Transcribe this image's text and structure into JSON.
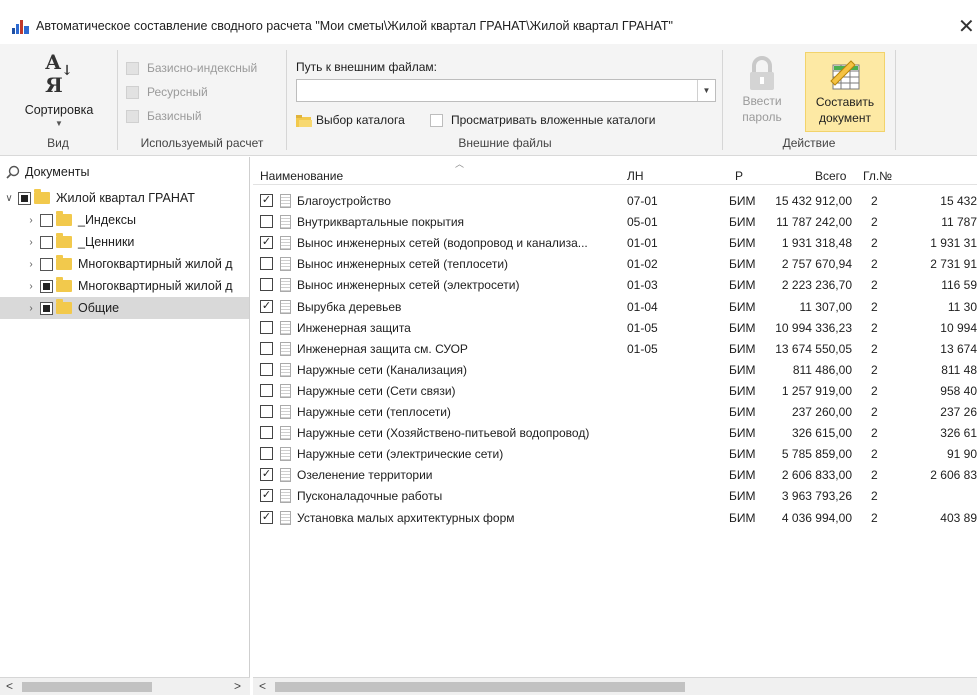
{
  "window": {
    "title": "Автоматическое составление сводного расчета \"Мои сметы\\Жилой квартал ГРАНАТ\\Жилой квартал ГРАНАТ\"",
    "close": "✕"
  },
  "ribbon": {
    "view": {
      "sort_label": "Сортировка",
      "sort_glyph_top": "А",
      "sort_glyph_bottom": "Я",
      "group_label": "Вид"
    },
    "calc": {
      "options": [
        "Базисно-индексный",
        "Ресурсный",
        "Базисный"
      ],
      "group_label": "Используемый расчет"
    },
    "external": {
      "path_label": "Путь к внешним файлам:",
      "path_value": "",
      "catalog_link": "Выбор каталога",
      "browse_nested": "Просматривать вложенные каталоги",
      "group_label": "Внешние файлы"
    },
    "action": {
      "password_line1": "Ввести",
      "password_line2": "пароль",
      "compose_line1": "Составить",
      "compose_line2": "документ",
      "group_label": "Действие"
    }
  },
  "tree": {
    "header": "Документы",
    "items": [
      {
        "label": "Жилой квартал ГРАНАТ",
        "expanded": true,
        "state": "partial"
      },
      {
        "label": "_Индексы",
        "state": "empty"
      },
      {
        "label": "_Ценники",
        "state": "empty"
      },
      {
        "label": "Многоквартирный жилой д",
        "state": "empty"
      },
      {
        "label": "Многоквартирный жилой д",
        "state": "partial"
      },
      {
        "label": "Общие",
        "state": "partial",
        "selected": true
      }
    ]
  },
  "grid": {
    "columns": [
      "Наименование",
      "ЛН",
      "Р",
      "Всего",
      "Гл.№",
      ""
    ],
    "rows": [
      {
        "checked": true,
        "name": "Благоустройство",
        "ln": "07-01",
        "r": "БИМ",
        "total": "15 432 912,00",
        "gl": "2",
        "extra": "15 432"
      },
      {
        "checked": false,
        "name": "Внутриквартальные покрытия",
        "ln": "05-01",
        "r": "БИМ",
        "total": "11 787 242,00",
        "gl": "2",
        "extra": "11 787"
      },
      {
        "checked": true,
        "name": "Вынос инженерных сетей (водопровод и канализа...",
        "ln": "01-01",
        "r": "БИМ",
        "total": "1 931 318,48",
        "gl": "2",
        "extra": "1 931 31"
      },
      {
        "checked": false,
        "name": "Вынос инженерных сетей (теплосети)",
        "ln": "01-02",
        "r": "БИМ",
        "total": "2 757 670,94",
        "gl": "2",
        "extra": "2 731 91"
      },
      {
        "checked": false,
        "name": "Вынос инженерных сетей (электросети)",
        "ln": "01-03",
        "r": "БИМ",
        "total": "2 223 236,70",
        "gl": "2",
        "extra": "116 59"
      },
      {
        "checked": true,
        "name": "Вырубка деревьев",
        "ln": "01-04",
        "r": "БИМ",
        "total": "11 307,00",
        "gl": "2",
        "extra": "11 30"
      },
      {
        "checked": false,
        "name": "Инженерная защита",
        "ln": "01-05",
        "r": "БИМ",
        "total": "10 994 336,23",
        "gl": "2",
        "extra": "10 994"
      },
      {
        "checked": false,
        "name": "Инженерная защита см. СУОР",
        "ln": "01-05",
        "r": "БИМ",
        "total": "13 674 550,05",
        "gl": "2",
        "extra": "13 674"
      },
      {
        "checked": false,
        "name": "Наружные сети (Канализация)",
        "ln": "",
        "r": "БИМ",
        "total": "811 486,00",
        "gl": "2",
        "extra": "811 48"
      },
      {
        "checked": false,
        "name": "Наружные сети (Сети связи)",
        "ln": "",
        "r": "БИМ",
        "total": "1 257 919,00",
        "gl": "2",
        "extra": "958 40"
      },
      {
        "checked": false,
        "name": "Наружные сети (теплосети)",
        "ln": "",
        "r": "БИМ",
        "total": "237 260,00",
        "gl": "2",
        "extra": "237 26"
      },
      {
        "checked": false,
        "name": "Наружные сети (Хозяйствено-питьевой водопровод)",
        "ln": "",
        "r": "БИМ",
        "total": "326 615,00",
        "gl": "2",
        "extra": "326 61"
      },
      {
        "checked": false,
        "name": "Наружные сети (электрические сети)",
        "ln": "",
        "r": "БИМ",
        "total": "5 785 859,00",
        "gl": "2",
        "extra": "91 90"
      },
      {
        "checked": true,
        "name": "Озеленение территории",
        "ln": "",
        "r": "БИМ",
        "total": "2 606 833,00",
        "gl": "2",
        "extra": "2 606 83"
      },
      {
        "checked": true,
        "name": "Пусконаладочные работы",
        "ln": "",
        "r": "БИМ",
        "total": "3 963 793,26",
        "gl": "2",
        "extra": ""
      },
      {
        "checked": true,
        "name": "Установка малых архитектурных форм",
        "ln": "",
        "r": "БИМ",
        "total": "4 036 994,00",
        "gl": "2",
        "extra": "403 89"
      }
    ]
  },
  "scroll": {
    "left": "<",
    "right": ">"
  }
}
